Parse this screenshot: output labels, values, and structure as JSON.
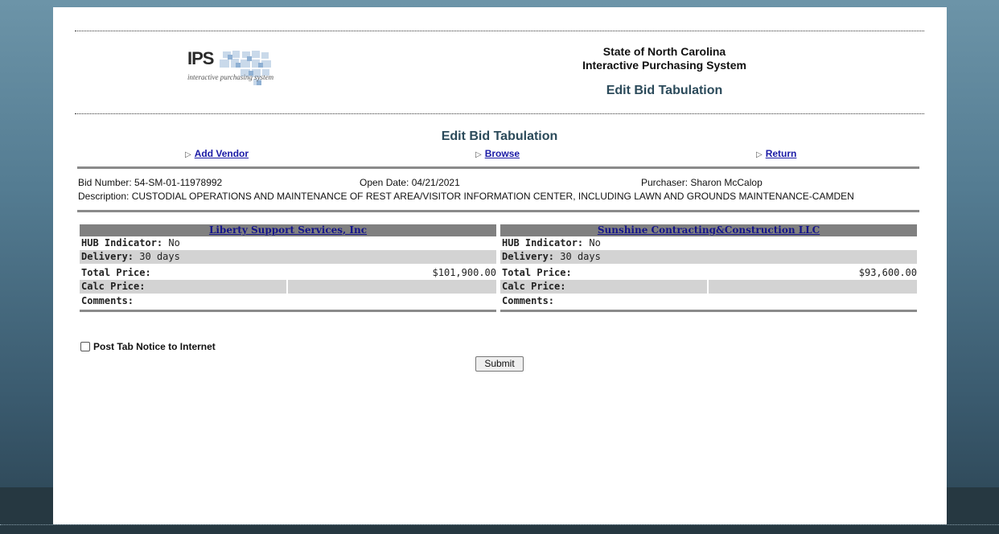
{
  "logo": {
    "mark": "IPS",
    "tagline": "interactive purchasing system"
  },
  "header": {
    "line1": "State of North Carolina",
    "line2": "Interactive Purchasing System",
    "subtitle": "Edit Bid Tabulation"
  },
  "page_title": "Edit Bid Tabulation",
  "nav": {
    "add_vendor": "Add Vendor",
    "browse": "Browse",
    "return": "Return"
  },
  "bid": {
    "number": "Bid Number: 54-SM-01-11978992",
    "open_date": "Open Date: 04/21/2021",
    "purchaser": "Purchaser: Sharon McCalop",
    "description": "Description: CUSTODIAL OPERATIONS AND MAINTENANCE OF REST AREA/VISITOR INFORMATION CENTER, INCLUDING LAWN AND GROUNDS MAINTENANCE-CAMDEN"
  },
  "labels": {
    "hub": "HUB Indicator:",
    "delivery": "Delivery:",
    "total": "Total Price:",
    "calc": "Calc Price:",
    "comments": "Comments:"
  },
  "vendors": [
    {
      "name": "Liberty Support Services, Inc",
      "hub": "No",
      "delivery": "30 days",
      "total": "$101,900.00"
    },
    {
      "name": "Sunshine Contracting&Construction LLC",
      "hub": "No",
      "delivery": "30 days",
      "total": "$93,600.00"
    }
  ],
  "post_notice_label": "Post Tab Notice to Internet",
  "submit_label": "Submit",
  "colors": {
    "heading": "#2b4a5a",
    "link": "#1a1aa6",
    "rule": "#8a8a8a"
  }
}
